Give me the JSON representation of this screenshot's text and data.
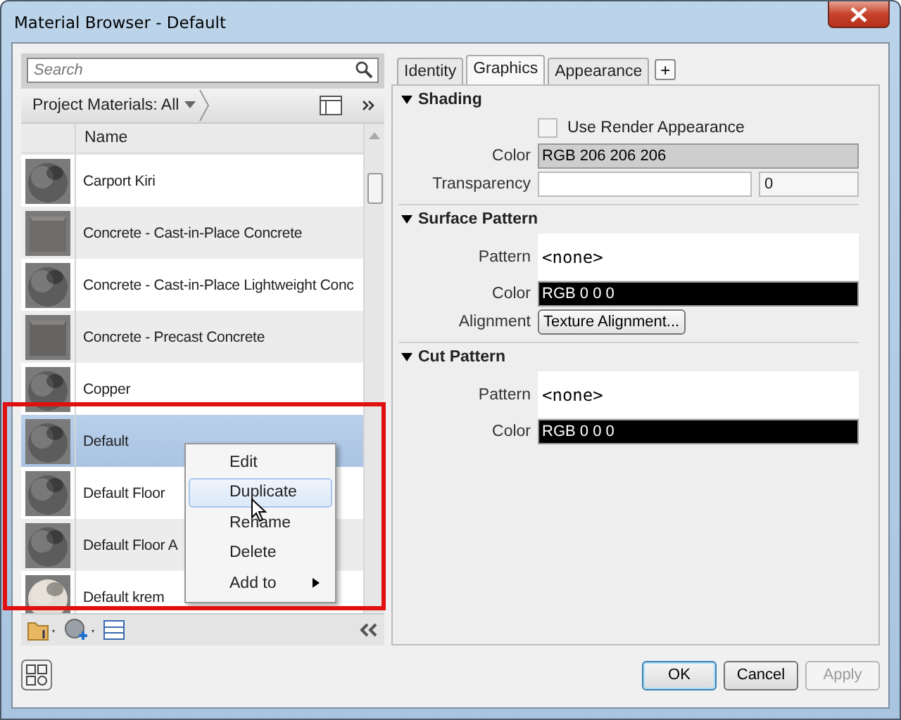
{
  "window": {
    "title": "Material Browser - Default"
  },
  "search": {
    "placeholder": "Search"
  },
  "library_filter": {
    "label": "Project Materials: All"
  },
  "list_header": {
    "name": "Name"
  },
  "materials": [
    {
      "name": "Carport Kiri",
      "kind": "sphere",
      "color": "#5c5c5c",
      "selected": false
    },
    {
      "name": "Concrete - Cast-in-Place Concrete",
      "kind": "cube",
      "color": "#6e6b68",
      "selected": false
    },
    {
      "name": "Concrete - Cast-in-Place Lightweight Conc",
      "kind": "sphere",
      "color": "#5c5c5c",
      "selected": false
    },
    {
      "name": "Concrete - Precast Concrete",
      "kind": "cube",
      "color": "#666462",
      "selected": false
    },
    {
      "name": "Copper",
      "kind": "sphere",
      "color": "#5c5c5c",
      "selected": false
    },
    {
      "name": "Default",
      "kind": "sphere",
      "color": "#5c5c5c",
      "selected": true
    },
    {
      "name": "Default Floor",
      "kind": "sphere",
      "color": "#5c5c5c",
      "selected": false
    },
    {
      "name": "Default Floor A",
      "kind": "sphere",
      "color": "#5c5c5c",
      "selected": false
    },
    {
      "name": "Default krem",
      "kind": "sphere",
      "color": "#e2ddd2",
      "selected": false
    }
  ],
  "context_menu": [
    {
      "label": "Edit",
      "highlighted": false,
      "submenu": false
    },
    {
      "label": "Duplicate",
      "highlighted": true,
      "submenu": false
    },
    {
      "label": "Rename",
      "highlighted": false,
      "submenu": false
    },
    {
      "label": "Delete",
      "highlighted": false,
      "submenu": false
    },
    {
      "label": "Add to",
      "highlighted": false,
      "submenu": true
    }
  ],
  "tabs": [
    {
      "label": "Identity",
      "selected": false
    },
    {
      "label": "Graphics",
      "selected": true
    },
    {
      "label": "Appearance",
      "selected": false
    }
  ],
  "add_tab": {
    "label": "+"
  },
  "sections": [
    {
      "title": "Shading",
      "expanded": true,
      "properties": [
        {
          "kind": "checkbox",
          "label": "Use Render Appearance",
          "checked": false
        },
        {
          "kind": "color",
          "label": "Color",
          "value": "RGB 206 206 206",
          "color": "#cecece"
        },
        {
          "kind": "slider",
          "label": "Transparency",
          "value": "0",
          "level": 0
        }
      ]
    },
    {
      "title": "Surface Pattern",
      "expanded": true,
      "properties": [
        {
          "kind": "pattern",
          "label": "Pattern",
          "value": "<none>"
        },
        {
          "kind": "color",
          "label": "Color",
          "value": "RGB 0 0 0",
          "color": "#000000"
        },
        {
          "kind": "button",
          "label": "Alignment",
          "value": "Texture Alignment..."
        }
      ]
    },
    {
      "title": "Cut Pattern",
      "expanded": true,
      "properties": [
        {
          "kind": "pattern",
          "label": "Pattern",
          "value": "<none>"
        },
        {
          "kind": "color",
          "label": "Color",
          "value": "RGB 0 0 0",
          "color": "#000000"
        }
      ]
    }
  ],
  "buttons": [
    {
      "label": "OK",
      "default": true,
      "disabled": false
    },
    {
      "label": "Cancel",
      "default": false,
      "disabled": false
    },
    {
      "label": "Apply",
      "default": false,
      "disabled": true
    }
  ]
}
